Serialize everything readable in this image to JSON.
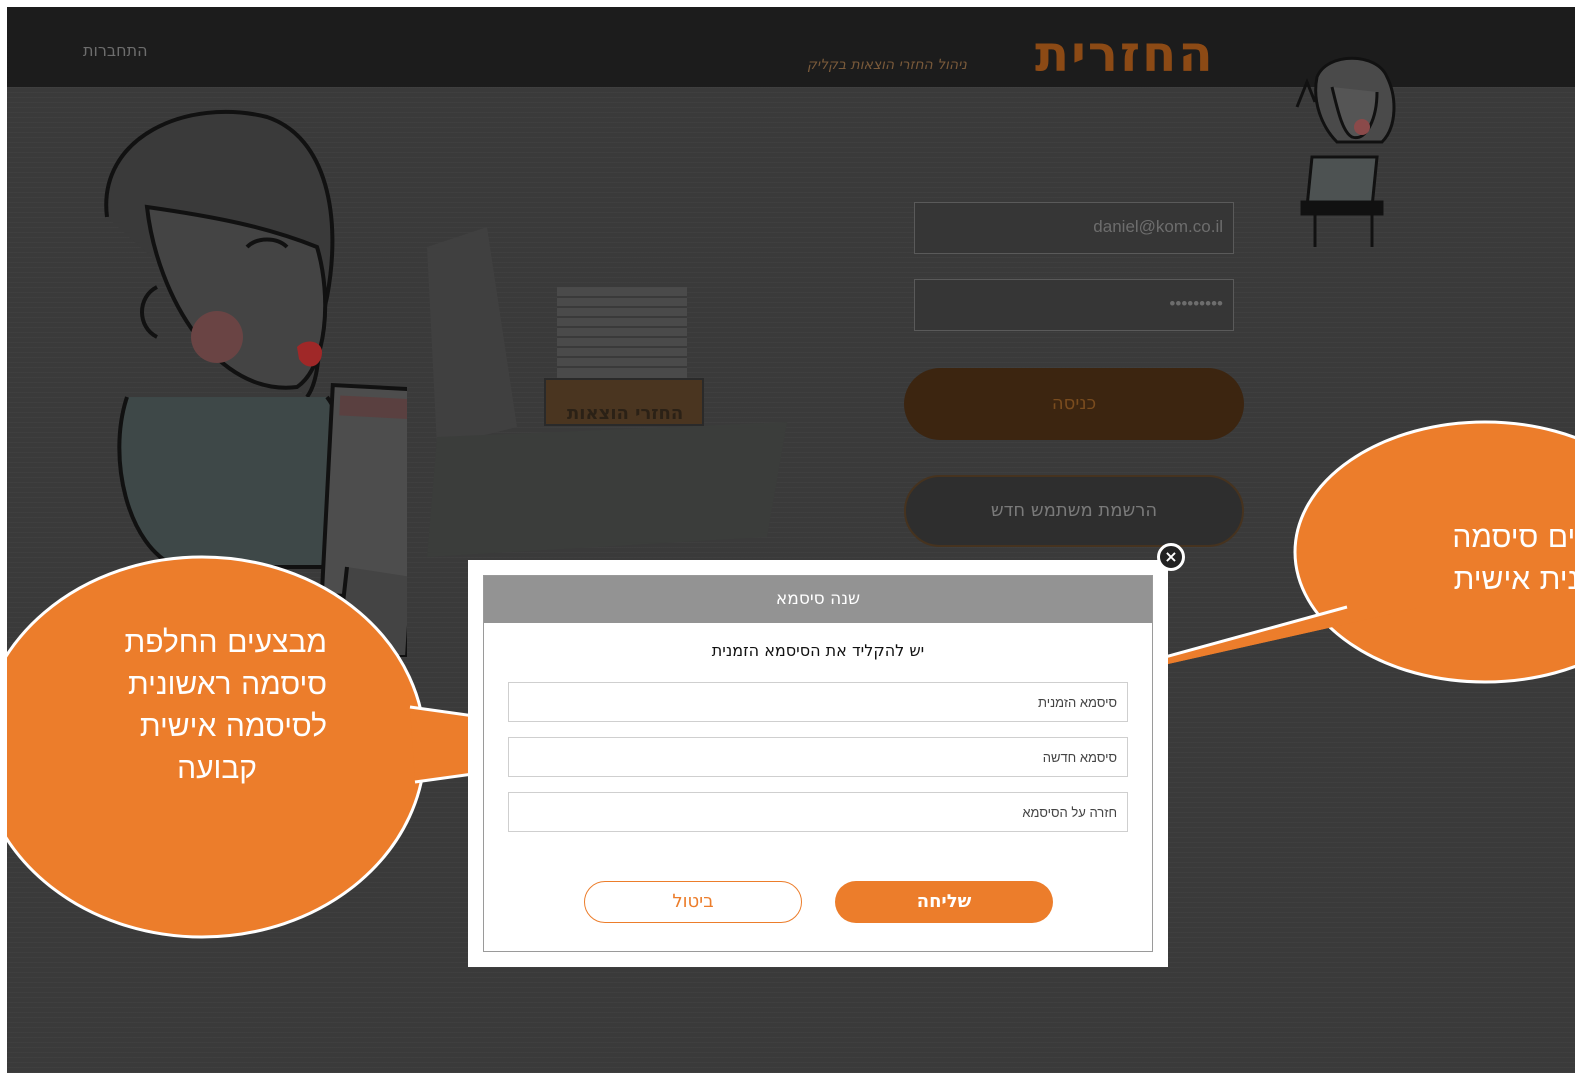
{
  "header": {
    "nav_connect": "התחברות",
    "logo": "החזרית",
    "tagline": "ניהול החזרי הוצאות בקליק"
  },
  "illustration": {
    "tray_label": "החזרי הוצאות"
  },
  "login": {
    "email_value": "daniel@kom.co.il",
    "password_value": "•••••••••",
    "login_label": "כניסה",
    "register_label": "הרשמת משתמש חדש"
  },
  "modal": {
    "title": "שנה סיסמא",
    "prompt": "יש להקליד את הסיסמא הזמנית",
    "temp_password_placeholder": "סיסמא הזמנית",
    "new_password_placeholder": "סיסמא חדשה",
    "repeat_password_placeholder": "חזרה על הסיסמא",
    "send_label": "שליחה",
    "cancel_label": "ביטול",
    "close_icon": "close-icon"
  },
  "callouts": {
    "left_lines": [
      "מבצעים החלפת",
      "סיסמה ראשונית",
      "לסיסמה אישית",
      "קבועה"
    ],
    "right_lines": [
      "נים סיסמה",
      "ונית  אישית"
    ]
  },
  "colors": {
    "accent": "#ec7d2b",
    "overlay": "#3a3a3a",
    "modal_header": "#939393"
  }
}
